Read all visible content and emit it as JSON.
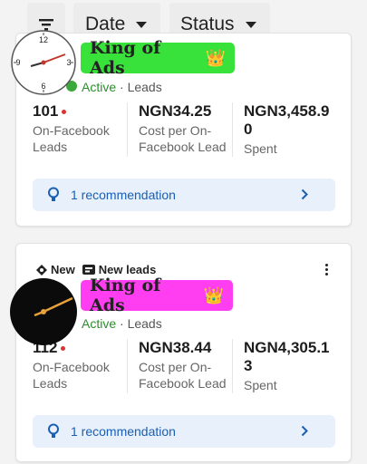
{
  "topbar": {
    "filter_icon": "filter-lines-icon",
    "date_label": "Date",
    "status_label": "Status"
  },
  "cards": [
    {
      "status": "Active",
      "separator": " · ",
      "objective": "Leads",
      "metrics": [
        {
          "value": "101",
          "label": "On-Facebook Leads"
        },
        {
          "value": "NGN34.25",
          "label": "Cost per On-Facebook Lead"
        },
        {
          "value": "NGN3,458.90",
          "label": "Spent"
        }
      ],
      "recommendation": "1 recommendation"
    },
    {
      "tag_new": "New",
      "tag_new_leads": "New leads",
      "status": "Active",
      "separator": " · ",
      "objective": "Leads",
      "metrics": [
        {
          "value": "112",
          "label": "On-Facebook Leads"
        },
        {
          "value": "NGN38.44",
          "label": "Cost per On-Facebook Lead"
        },
        {
          "value": "NGN4,305.13",
          "label": "Spent"
        }
      ],
      "recommendation": "1 recommendation"
    }
  ],
  "overlays": {
    "badge1_text": "King of Ads",
    "badge2_text": "King of Ads",
    "crown": "👑",
    "badge1_color": "#39e23a",
    "badge2_color": "#ff3ef2",
    "clock_numbers": [
      "12",
      "3",
      "6",
      "9"
    ]
  },
  "colors": {
    "accent_blue": "#1a5fb4",
    "active_green": "#2a8f2a",
    "rec_bg": "#e7f0fb"
  }
}
